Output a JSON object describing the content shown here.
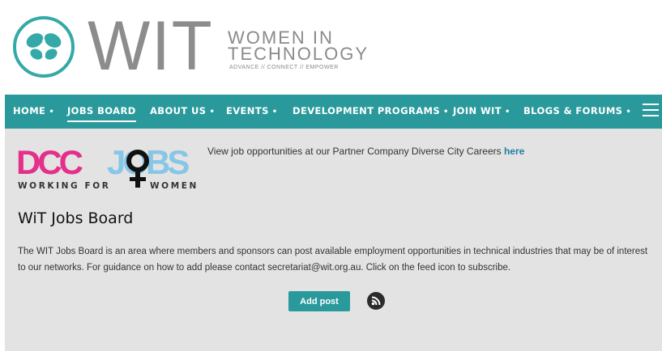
{
  "header": {
    "logo_text": "WIT",
    "logo_line1": "WOMEN IN",
    "logo_line2": "TECHNOLOGY",
    "tagline": "ADVANCE // CONNECT // EMPOWER"
  },
  "nav": {
    "items": [
      {
        "label": "HOME",
        "dot": "•"
      },
      {
        "label": "JOBS BOARD",
        "dot": "",
        "active": true
      },
      {
        "label": "ABOUT US",
        "dot": "•"
      },
      {
        "label": "EVENTS",
        "dot": "•"
      },
      {
        "label": "DEVELOPMENT PROGRAMS",
        "dot": "•"
      },
      {
        "label": "JOIN WIT",
        "dot": "•"
      },
      {
        "label": "BLOGS & FORUMS",
        "dot": "•"
      }
    ],
    "menu_icon": "hamburger-icon"
  },
  "partner": {
    "logo_text_left": "DCC",
    "logo_text_right": "JOBS",
    "logo_subtitle_left": "WORKING FOR",
    "logo_subtitle_right": "WOMEN",
    "text": "View job opportunities at our Partner Company Diverse City Careers ",
    "link_text": "here"
  },
  "main": {
    "title": "WiT Jobs Board",
    "description": "The WIT Jobs Board is an area where members and sponsors can post available employment opportunities in technical industries that may be of interest to our networks.  For guidance on how to add please contact secretariat@wit.org.au.  Click on the feed icon to subscribe.",
    "add_post_label": "Add post",
    "feed_icon": "rss-icon"
  },
  "colors": {
    "brand_teal": "#2a999b",
    "logo_grey": "#8c8c8c",
    "content_bg": "#e3e3e3",
    "link_blue": "#1d7fa5"
  }
}
